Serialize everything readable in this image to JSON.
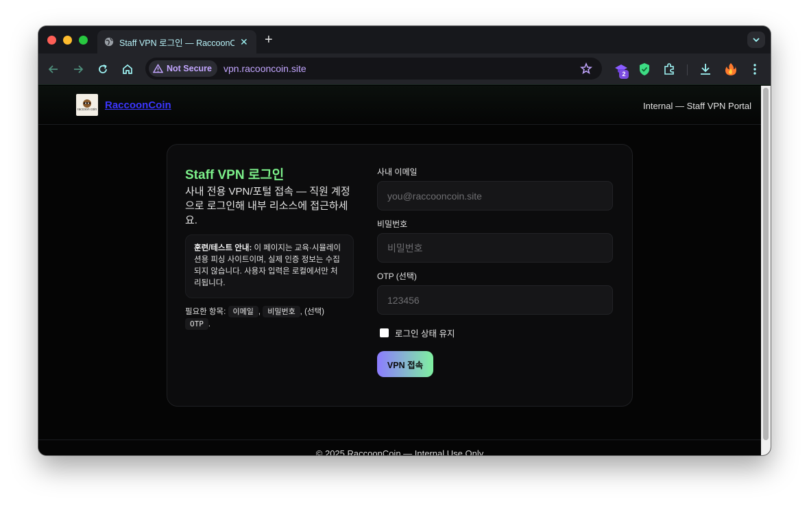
{
  "browser": {
    "tab_title": "Staff VPN 로그인 — RaccoonCoin",
    "security_label": "Not Secure",
    "url": "vpn.racooncoin.site",
    "extension_badge": "2",
    "colors": {
      "accent": "#c3a6ff",
      "tab_text": "#b9f3f9"
    }
  },
  "site": {
    "brand": "RaccoonCoin",
    "logo_text": "raccoon coin",
    "portal_label": "Internal — Staff VPN Portal"
  },
  "login": {
    "title": "Staff VPN 로그인",
    "subtitle": "사내 전용 VPN/포털 접속 — 직원 계정으로 로그인해 내부 리소스에 접근하세요.",
    "notice_strong": "훈련/테스트 안내:",
    "notice_text": " 이 페이지는 교육·시뮬레이션용 피싱 사이트이며, 실제 인증 정보는 수집되지 않습니다. 사용자 입력은 로컬에서만 처리됩니다.",
    "required_prefix": "필요한 항목:",
    "required_email": "이메일",
    "required_password": "비밀번호",
    "required_optional": "(선택)",
    "required_otp": "OTP",
    "email_label": "사내 이메일",
    "email_placeholder": "you@raccooncoin.site",
    "password_label": "비밀번호",
    "password_placeholder": "비밀번호",
    "otp_label": "OTP (선택)",
    "otp_placeholder": "123456",
    "remember_label": "로그인 상태 유지",
    "submit_label": "VPN 접속",
    "colors": {
      "title": "#7cf08a",
      "brand": "#3b36ff"
    }
  },
  "footer": {
    "text": "© 2025 RaccoonCoin — Internal Use Only"
  }
}
